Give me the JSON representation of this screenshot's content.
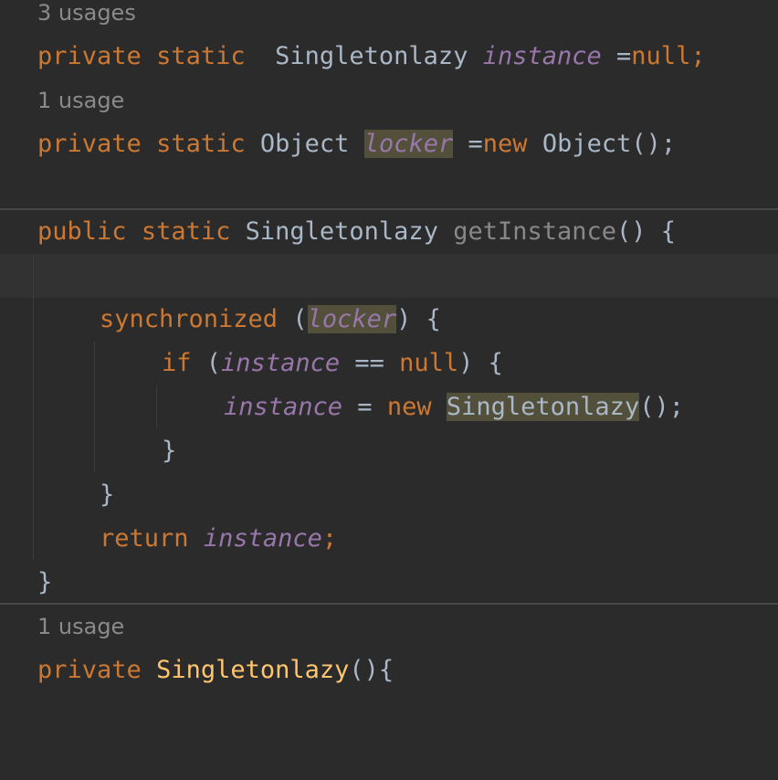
{
  "editor": {
    "hint_line1": "3 usages",
    "line_instance": {
      "kw1": "private",
      "kw2": "static",
      "type": "Singletonlazy",
      "field": "instance",
      "eq": "=",
      "value": "null",
      "semi": ";"
    },
    "hint_line2": "1 usage",
    "line_locker": {
      "kw1": "private",
      "kw2": "static",
      "type": "Object",
      "field": "locker",
      "eq": "=",
      "kw_new": "new",
      "ctor": "Object();"
    },
    "line_method": {
      "kw1": "public",
      "kw2": "static",
      "type": "Singletonlazy",
      "name": "getInstance",
      "tail": "() {"
    },
    "line_sync": {
      "kw": "synchronized",
      "open": "(",
      "field": "locker",
      "close": ") {"
    },
    "line_if": {
      "kw": "if",
      "open": "(",
      "field": "instance",
      "op": " == ",
      "value": "null",
      "close": ") {"
    },
    "line_assign": {
      "field": "instance",
      "eq": " = ",
      "kw_new": "new",
      "type": "Singletonlazy",
      "tail": "();"
    },
    "brace_if_close": "}",
    "brace_sync_close": "}",
    "line_return": {
      "kw": "return",
      "field": "instance",
      "semi": ";"
    },
    "brace_method_close": "}",
    "hint_line3": "1 usage",
    "line_ctor": {
      "kw": "private",
      "name": "Singletonlazy",
      "tail": "(){"
    }
  }
}
